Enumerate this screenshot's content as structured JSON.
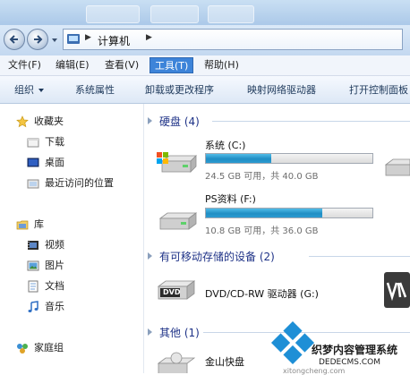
{
  "address": {
    "location": "计算机"
  },
  "menu": [
    {
      "label": "文件(F)",
      "active": false
    },
    {
      "label": "编辑(E)",
      "active": false
    },
    {
      "label": "查看(V)",
      "active": false
    },
    {
      "label": "工具(T)",
      "active": true
    },
    {
      "label": "帮助(H)",
      "active": false
    }
  ],
  "commands": {
    "organize": "组织",
    "system_properties": "系统属性",
    "uninstall": "卸载或更改程序",
    "map_drive": "映射网络驱动器",
    "control_panel": "打开控制面板"
  },
  "nav": {
    "favorites": "收藏夹",
    "downloads": "下载",
    "desktop": "桌面",
    "recent": "最近访问的位置",
    "libraries": "库",
    "videos": "视频",
    "pictures": "图片",
    "documents": "文档",
    "music": "音乐",
    "homegroup": "家庭组"
  },
  "groups": {
    "hard_disks": "硬盘 (4)",
    "removable": "有可移动存储的设备 (2)",
    "other": "其他 (1)"
  },
  "drives": [
    {
      "name": "系统 (C:)",
      "meta": "24.5 GB 可用，共 40.0 GB",
      "used_fraction": 0.39
    },
    {
      "name": "PS资料 (F:)",
      "meta": "10.8 GB 可用，共 36.0 GB",
      "used_fraction": 0.7
    }
  ],
  "dvd": {
    "name": "DVD/CD-RW 驱动器 (G:)",
    "icon_label": "DVD"
  },
  "other_item": {
    "name": "金山快盘"
  },
  "watermark": {
    "title": "织梦内容管理系统",
    "url": "DEDECMS.COM",
    "url2": "xitongcheng.com"
  }
}
